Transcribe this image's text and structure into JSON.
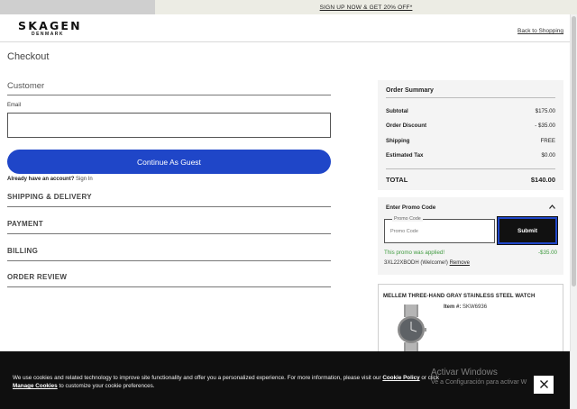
{
  "promo_bar": {
    "text": "SIGN UP NOW & GET 20% OFF*"
  },
  "header": {
    "brand": "SKAGEN",
    "brand_sub": "DENMARK",
    "back_link": "Back to Shopping"
  },
  "page_title": "Checkout",
  "customer": {
    "heading": "Customer",
    "email_label": "Email",
    "email_value": "",
    "continue_button": "Continue As Guest",
    "account_prompt": "Already have an account?",
    "sign_in": "Sign In"
  },
  "steps": [
    "SHIPPING & DELIVERY",
    "PAYMENT",
    "BILLING",
    "ORDER REVIEW"
  ],
  "order_summary": {
    "title": "Order Summary",
    "rows": [
      {
        "label": "Subtotal",
        "value": "$175.00"
      },
      {
        "label": "Order Discount",
        "value": "- $35.00"
      },
      {
        "label": "Shipping",
        "value": "FREE"
      },
      {
        "label": "Estimated Tax",
        "value": "$0.00"
      }
    ],
    "total_label": "TOTAL",
    "total_value": "$140.00"
  },
  "promo": {
    "heading": "Enter Promo Code",
    "field_label": "Promo Code",
    "placeholder": "Promo Code",
    "submit": "Submit",
    "applied_text": "This promo was applied!",
    "applied_amount": "-$35.00",
    "code": "3XL22XBODH (Welcome!)",
    "remove": "Remove"
  },
  "item": {
    "name": "MELLEM THREE-HAND GRAY STAINLESS STEEL WATCH",
    "sku_label": "Item #:",
    "sku": "SKW6936"
  },
  "cookie": {
    "text_before": "We use cookies and related technology to improve site functionality and offer you a personalized experience. For more information, please visit our",
    "policy_link": "Cookie Policy",
    "text_middle": "or click",
    "manage_link": "Manage Cookies",
    "text_after": "to customize your cookie preferences.",
    "watermark_title": "Activar Windows",
    "watermark_sub": "Ve a Configuración para activar W"
  },
  "colors": {
    "accent_blue": "#1f46c8",
    "promo_green": "#3f9a3f",
    "cookie_bg": "#0f0f0f"
  },
  "icons": {
    "close": "close-icon",
    "collapse": "chevron-up-icon"
  }
}
